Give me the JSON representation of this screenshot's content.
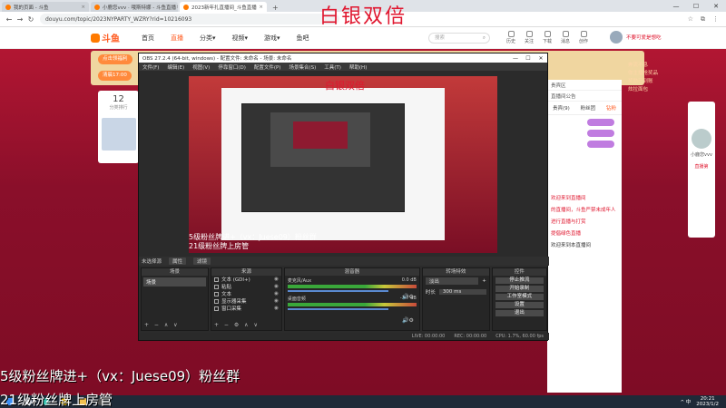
{
  "browser": {
    "tabs": [
      {
        "label": "我的页面 - 斗鱼",
        "active": false
      },
      {
        "label": "小鹿您vvv · 哦斯特娜 - 斗鱼直播",
        "active": false
      },
      {
        "label": "2023新年扎直播间_斗鱼直播",
        "active": true
      }
    ],
    "new_tab": "+",
    "url": "douyu.com/topic/2023NYPARTY_WZRY?rid=10216093",
    "nav": {
      "back": "←",
      "forward": "→",
      "reload": "↻"
    },
    "window_controls": {
      "minimize": "—",
      "maximize": "☐",
      "close": "✕"
    }
  },
  "overlay_title": "白银双倍",
  "site": {
    "logo": "斗鱼",
    "nav": [
      "首页",
      "直播",
      "分类▾",
      "视频▾",
      "游戏▾",
      "鱼吧"
    ],
    "active_nav": 1,
    "search_placeholder": "搜索",
    "icons": [
      {
        "name": "history-icon",
        "label": "历史"
      },
      {
        "name": "follow-icon",
        "label": "关注"
      },
      {
        "name": "download-icon",
        "label": "下载"
      },
      {
        "name": "message-icon",
        "label": "消息"
      },
      {
        "name": "creator-icon",
        "label": "创作"
      }
    ],
    "user_text": "不要可爱是想吃"
  },
  "left_panel": {
    "count": "12",
    "label": "分类排行"
  },
  "pills": [
    "点击领福利",
    "清晨17:00"
  ],
  "right_panel": {
    "rows": [
      "贵宾区",
      "直播间公告"
    ],
    "tabs": [
      "贵宾(9)",
      "粉丝团",
      "钻粉"
    ],
    "messages": [
      "欢迎来到直播间",
      "的直播间，斗鱼严禁未成年人",
      "进行直播与打赏",
      "提倡绿色直播",
      "欢迎来到本直播间"
    ]
  },
  "far_right": {
    "lines": [
      "奔流不息",
      "你主播抢奖品",
      "奖励已到账",
      "炫拉面包",
      "小鹿您vvv"
    ],
    "badge": "直播第"
  },
  "obs": {
    "title": "OBS 27.2.4 (64-bit, windows) - 配置文件: 未命名 - 场景: 未命名",
    "menu": [
      "文件(F)",
      "编辑(E)",
      "视图(V)",
      "停靠窗口(D)",
      "配置文件(P)",
      "场景集合(S)",
      "工具(T)",
      "帮助(H)"
    ],
    "preview_title": "白银双倍",
    "preview_banner1": "5级粉丝牌进+（vx：Juese09）粉丝群",
    "preview_banner2": "21级粉丝牌上房管",
    "scene_label": "未选择源",
    "scene_buttons": [
      "属性",
      "滤镜"
    ],
    "docks": {
      "scenes": {
        "header": "场景",
        "items": [
          "场景"
        ],
        "footer": "+ − ∧ ∨"
      },
      "sources": {
        "header": "来源",
        "items": [
          "文本 (GDI+)",
          "粘贴",
          "文本",
          "显示器采集",
          "窗口采集"
        ],
        "footer": "+ − ⚙ ∧ ∨"
      },
      "mixer": {
        "header": "混音器",
        "channels": [
          {
            "name": "麦克风/Aux",
            "db": "0.0 dB"
          },
          {
            "name": "桌面音频",
            "db": "-1.7 dB"
          }
        ]
      },
      "transitions": {
        "header": "转场特效",
        "type": "淡出",
        "duration_label": "时长",
        "duration": "300 ms"
      },
      "controls": {
        "header": "控件",
        "buttons": [
          "停止推流",
          "开始录制",
          "工作室模式",
          "设置",
          "退出"
        ]
      }
    },
    "status": [
      "LIVE: 00:00:00",
      "REC: 00:00:00",
      "CPU: 1.7%, 60.00 fps"
    ]
  },
  "banner_lines": [
    "5级粉丝牌进+（vx：Juese09）粉丝群",
    "21级粉丝牌上房管"
  ],
  "taskbar": {
    "apps": [
      "start-icon",
      "search-icon",
      "edge-icon",
      "chrome-icon",
      "folder-icon",
      "obs-icon"
    ],
    "time": "20:21",
    "date": "2023/1/2",
    "tray": "^ 中"
  }
}
